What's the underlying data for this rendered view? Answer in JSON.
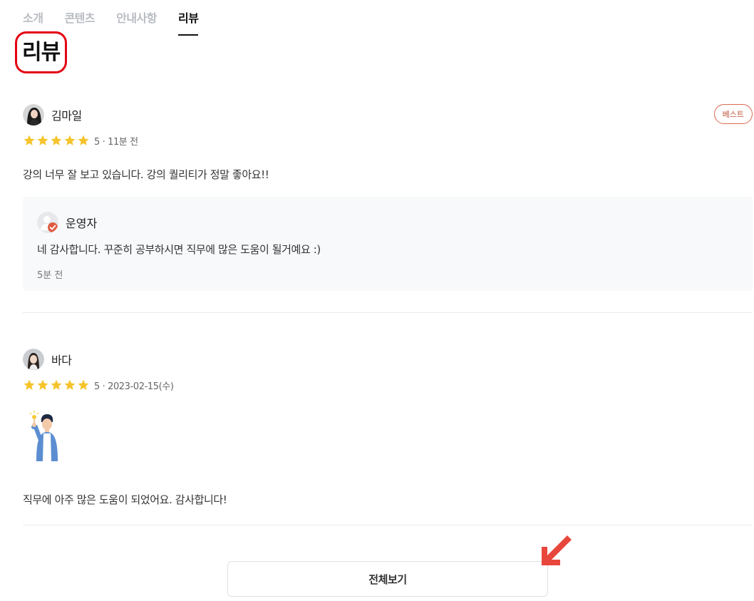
{
  "tabs": [
    {
      "label": "소개",
      "active": false
    },
    {
      "label": "콘텐츠",
      "active": false
    },
    {
      "label": "안내사항",
      "active": false
    },
    {
      "label": "리뷰",
      "active": true
    }
  ],
  "section_title": "리뷰",
  "reviews": [
    {
      "author": "김마일",
      "badge": "베스트",
      "rating": 5,
      "meta": "5 · 11분 전",
      "text": "강의 너무 잘 보고 있습니다. 강의 퀄리티가 정말 좋아요!!",
      "reply": {
        "author": "운영자",
        "text": "네 감사합니다. 꾸준히 공부하시면 직무에 많은 도움이 될거예요 :)",
        "time": "5분 전"
      }
    },
    {
      "author": "바다",
      "rating": 5,
      "meta": "5 · 2023-02-15(수)",
      "attachment_icon": "man-pointing-up-icon",
      "text": "직무에 아주 많은 도움이 되었어요. 감사합니다!"
    }
  ],
  "view_all_label": "전체보기",
  "colors": {
    "star": "#f5c42c",
    "badge": "#d9694f",
    "highlight": "#e50012",
    "reply_bg": "#f8f9fb"
  }
}
